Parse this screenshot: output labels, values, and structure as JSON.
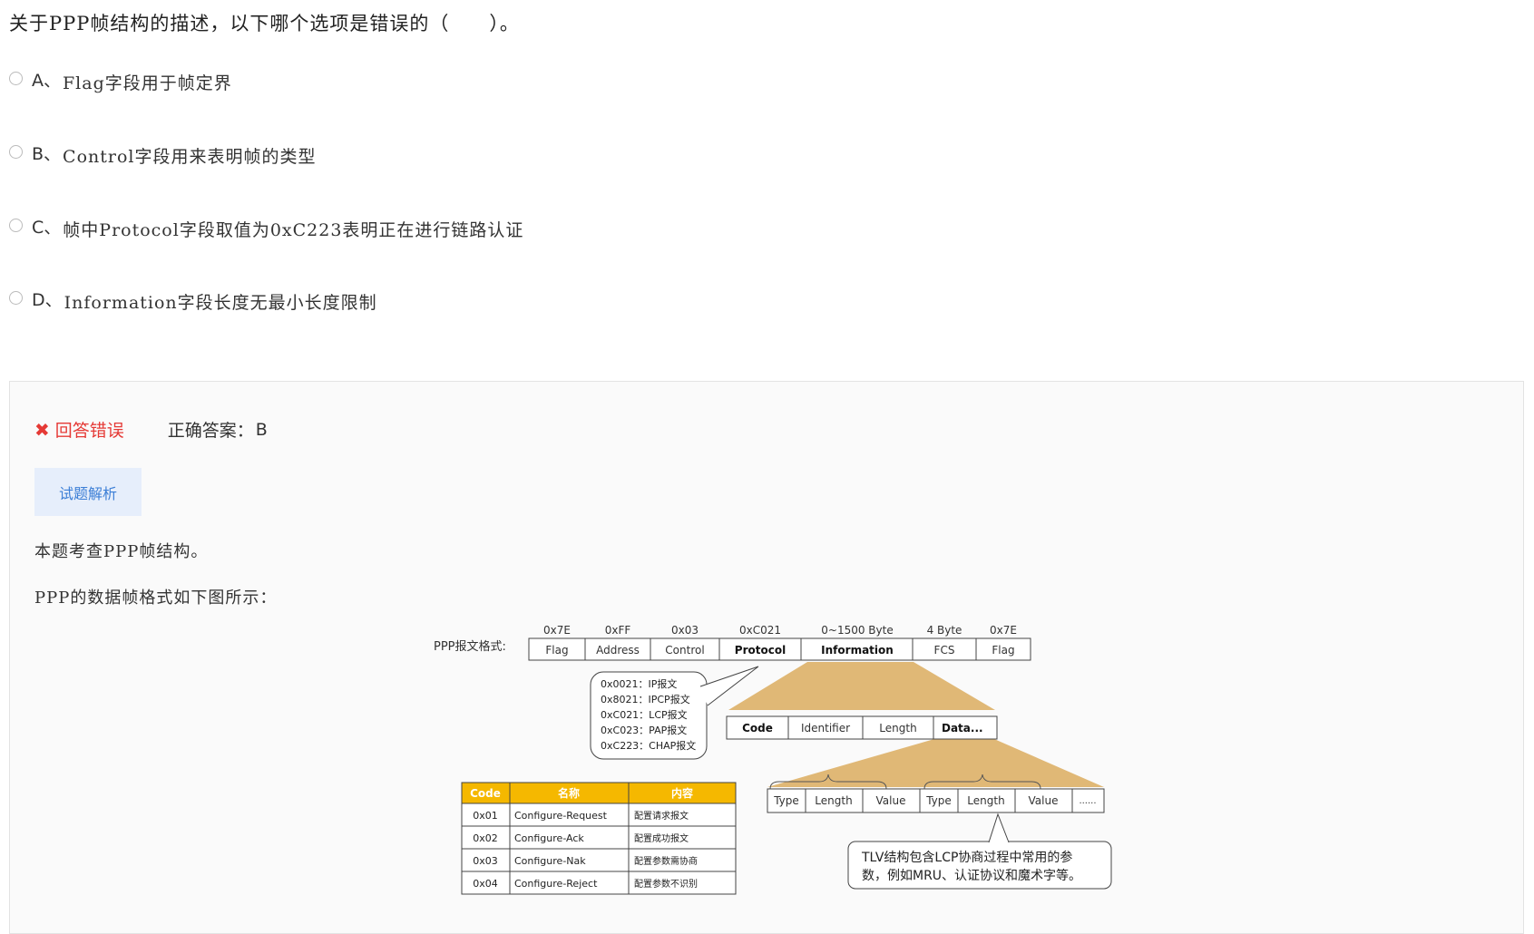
{
  "question": "关于PPP帧结构的描述，以下哪个选项是错误的（　　）。",
  "options": [
    {
      "letter": "A、",
      "text": "Flag字段用于帧定界"
    },
    {
      "letter": "B、",
      "text": "Control字段用来表明帧的类型"
    },
    {
      "letter": "C、",
      "text": "帧中Protocol字段取值为0xC223表明正在进行链路认证"
    },
    {
      "letter": "D、",
      "text": "Information字段长度无最小长度限制"
    }
  ],
  "result": {
    "icon": "close-icon",
    "status": "回答错误",
    "answer_label": "正确答案：",
    "answer_value": "B",
    "status_color": "#e53935"
  },
  "analysis_tab": "试题解析",
  "explanation": [
    "本题考查PPP帧结构。",
    "PPP的数据帧格式如下图所示："
  ],
  "figure": {
    "format_label": "PPP报文格式:",
    "fields": [
      {
        "value": "0x7E",
        "name": "Flag"
      },
      {
        "value": "0xFF",
        "name": "Address"
      },
      {
        "value": "0x03",
        "name": "Control"
      },
      {
        "value": "0xC021",
        "name": "Protocol"
      },
      {
        "value": "0~1500 Byte",
        "name": "Information"
      },
      {
        "value": "4 Byte",
        "name": "FCS"
      },
      {
        "value": "0x7E",
        "name": "Flag"
      }
    ],
    "protocol_values": [
      "0x0021：IP报文",
      "0x8021：IPCP报文",
      "0xC021：LCP报文",
      "0xC023：PAP报文",
      "0xC223：CHAP报文"
    ],
    "lcp_fields": [
      "Code",
      "Identifier",
      "Length",
      "Data..."
    ],
    "code_table": {
      "headers": [
        "Code",
        "名称",
        "内容"
      ],
      "rows": [
        [
          "0x01",
          "Configure-Request",
          "配置请求报文"
        ],
        [
          "0x02",
          "Configure-Ack",
          "配置成功报文"
        ],
        [
          "0x03",
          "Configure-Nak",
          "配置参数需协商"
        ],
        [
          "0x04",
          "Configure-Reject",
          "配置参数不识别"
        ]
      ]
    },
    "tlv_fields": [
      "Type",
      "Length",
      "Value",
      "Type",
      "Length",
      "Value",
      "......"
    ],
    "tlv_note": [
      "TLV结构包含LCP协商过程中常用的参",
      "数，例如MRU、认证协议和魔术字等。"
    ],
    "header_color": "#f5b800",
    "fan_color": "#e0b876"
  }
}
